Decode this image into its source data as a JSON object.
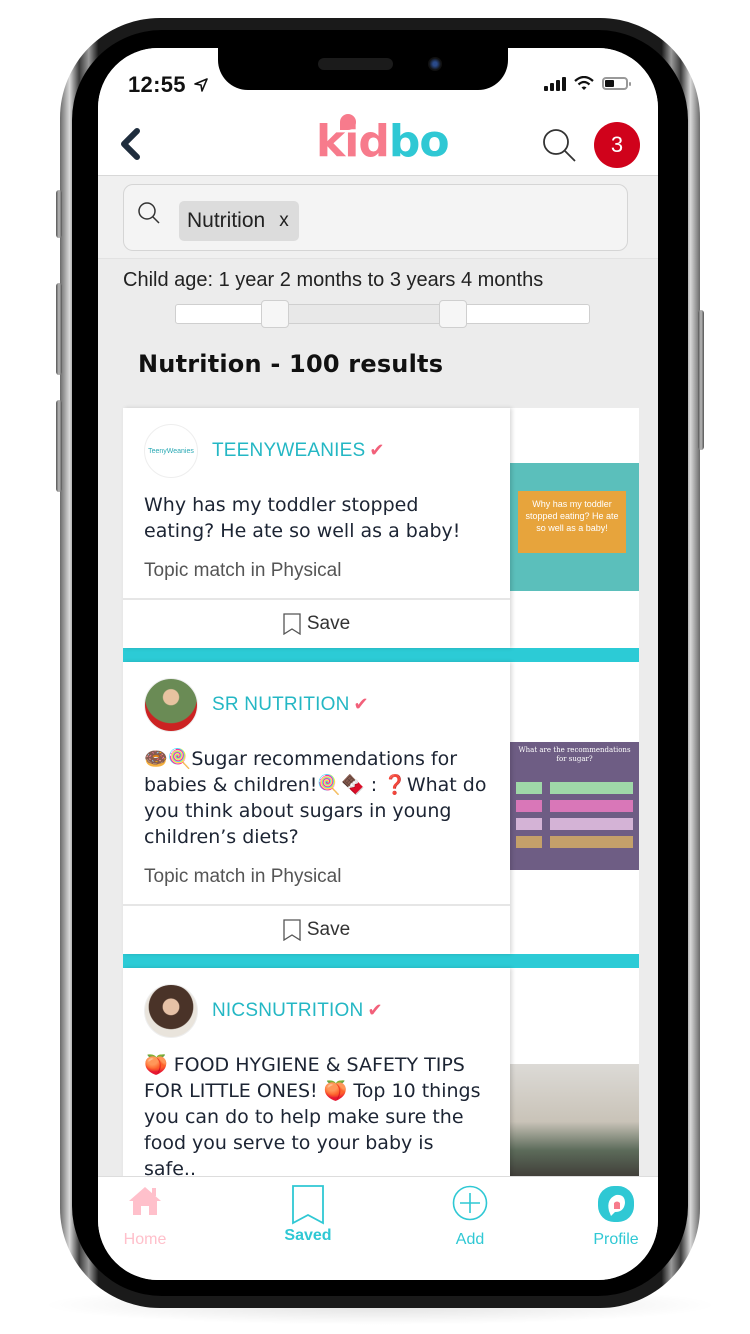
{
  "status_bar": {
    "time": "12:55",
    "location_icon": "location-arrow-icon",
    "signal_icon": "cellular-signal-icon",
    "wifi_icon": "wifi-icon",
    "battery_icon": "battery-icon"
  },
  "header": {
    "back_icon": "chevron-left-icon",
    "logo_part1": "kid",
    "logo_part2": "bo",
    "search_icon": "search-icon",
    "notification_count": "3",
    "colors": {
      "pink": "#f77b8c",
      "teal": "#2fc8d4",
      "badge": "#d0021b"
    }
  },
  "search": {
    "chip_label": "Nutrition",
    "chip_remove": "x"
  },
  "age_filter": {
    "label": "Child age: 1 year 2 months to 3 years 4 months",
    "range_min_fraction": 0.24,
    "range_max_fraction": 0.67
  },
  "results": {
    "title": "Nutrition - 100 results"
  },
  "cards": [
    {
      "author": "TEENYWEANIES",
      "avatar_text": "TeenyWeanies",
      "verified": "✔",
      "text": "Why has my toddler stopped eating? He ate so well as a baby!",
      "topic": "Topic match in Physical",
      "save_label": "Save",
      "thumb_text": "Why has my toddler stopped eating? He ate so well as a baby!"
    },
    {
      "author": "SR NUTRITION",
      "verified": "✔",
      "text": "🍩🍭Sugar recommendations for babies & children!🍭🍫 : ❓What do you think about sugars in young children’s diets?",
      "topic": "Topic match in Physical",
      "save_label": "Save",
      "thumb_title": "What are the recommendations for sugar?"
    },
    {
      "author": "NICSNUTRITION",
      "verified": "✔",
      "text": "🍑 FOOD HYGIENE & SAFETY TIPS FOR LITTLE ONES! 🍑 Top 10 things you can do to help make sure the food you serve to your baby is safe.."
    }
  ],
  "bottom_nav": [
    {
      "label": "Home",
      "icon": "home-icon",
      "color": "#ffc0cb"
    },
    {
      "label": "Saved",
      "icon": "bookmark-icon",
      "color": "#2fc8d4",
      "active": true
    },
    {
      "label": "Add",
      "icon": "plus-circle-icon",
      "color": "#2fc8d4"
    },
    {
      "label": "Profile",
      "icon": "profile-logo-icon",
      "color": "#2fc8d4"
    }
  ]
}
